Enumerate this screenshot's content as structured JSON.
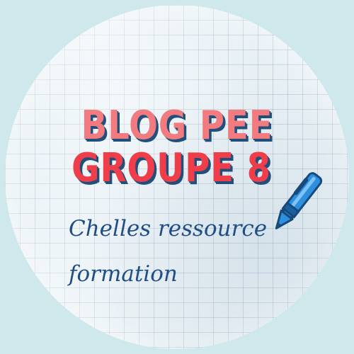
{
  "logo": {
    "title_line_1": "BLOG PEE",
    "title_line_2": "GROUPE 8",
    "subtitle_line_1": "Chelles ressource",
    "subtitle_line_2": "formation"
  },
  "colors": {
    "background": "#cfe8ec",
    "title_line_1": "#f27b80",
    "title_line_2": "#ef3d4a",
    "title_shadow": "#214f7c",
    "subtitle": "#1f4d86",
    "pen": "#2c8fe0"
  },
  "icons": {
    "pen": "pen-icon"
  }
}
